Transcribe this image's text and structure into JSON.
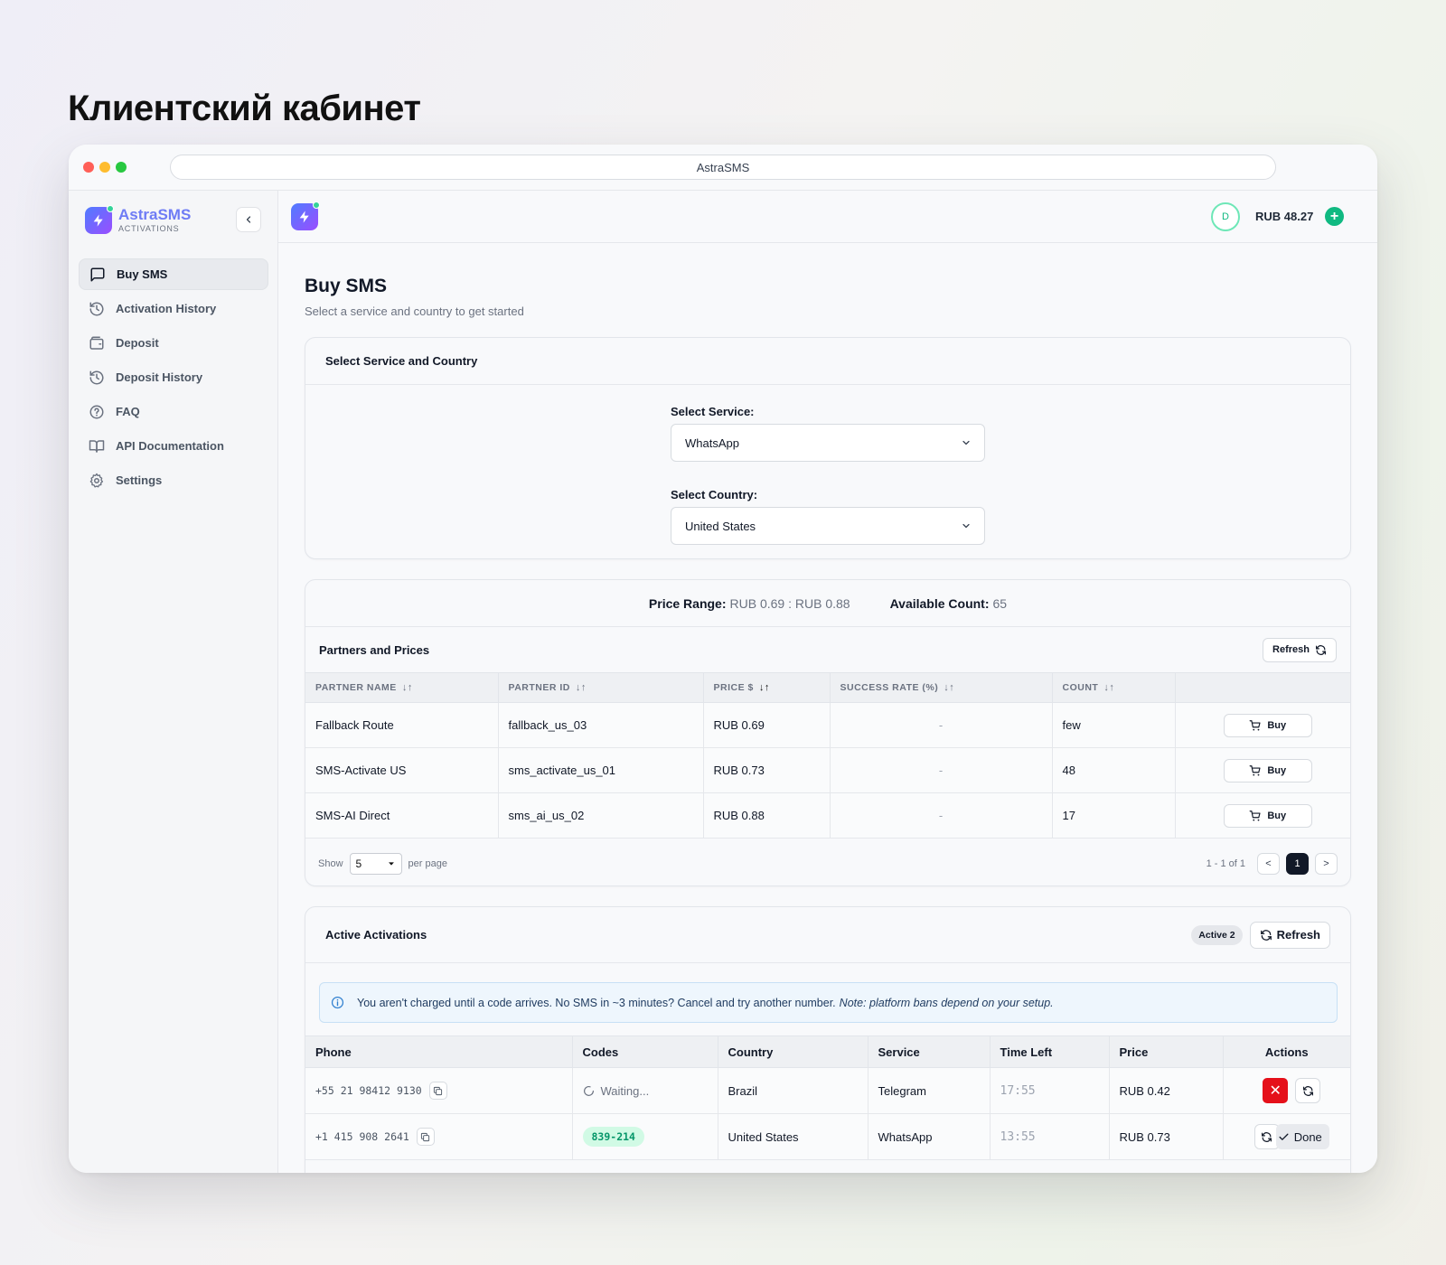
{
  "page_heading": "Клиентский кабинет",
  "browser": {
    "url_title": "AstraSMS"
  },
  "brand": {
    "name": "AstraSMS",
    "subtitle": "ACTIVATIONS"
  },
  "sidebar": {
    "items": [
      {
        "label": "Buy SMS",
        "icon": "message-square-icon",
        "active": true
      },
      {
        "label": "Activation History",
        "icon": "history-icon"
      },
      {
        "label": "Deposit",
        "icon": "wallet-icon"
      },
      {
        "label": "Deposit History",
        "icon": "history-icon"
      },
      {
        "label": "FAQ",
        "icon": "help-circle-icon"
      },
      {
        "label": "API Documentation",
        "icon": "book-open-icon"
      },
      {
        "label": "Settings",
        "icon": "gear-icon"
      }
    ]
  },
  "topbar": {
    "avatar_initial": "D",
    "balance": "RUB 48.27",
    "add_label": "+"
  },
  "main": {
    "title": "Buy SMS",
    "subtitle": "Select a service and country to get started"
  },
  "selector": {
    "header": "Select Service and Country",
    "service_label": "Select Service:",
    "service_value": "WhatsApp",
    "country_label": "Select Country:",
    "country_value": "United States"
  },
  "summary": {
    "price_range_label": "Price Range:",
    "price_range_value": "RUB 0.69 : RUB 0.88",
    "available_label": "Available Count:",
    "available_value": "65"
  },
  "partners": {
    "header": "Partners and Prices",
    "refresh_label": "Refresh",
    "columns": [
      "PARTNER NAME",
      "PARTNER ID",
      "PRICE $",
      "SUCCESS RATE (%)",
      "COUNT"
    ],
    "rows": [
      {
        "name": "Fallback Route",
        "id": "fallback_us_03",
        "price": "RUB 0.69",
        "success": "-",
        "count": "few",
        "action": "Buy"
      },
      {
        "name": "SMS-Activate US",
        "id": "sms_activate_us_01",
        "price": "RUB 0.73",
        "success": "-",
        "count": "48",
        "action": "Buy"
      },
      {
        "name": "SMS-AI Direct",
        "id": "sms_ai_us_02",
        "price": "RUB 0.88",
        "success": "-",
        "count": "17",
        "action": "Buy"
      }
    ],
    "pager": {
      "show_label": "Show",
      "per_page_value": "5",
      "per_page_label": "per page",
      "range": "1 - 1 of 1",
      "prev": "<",
      "current": "1",
      "next": ">"
    }
  },
  "activations": {
    "header": "Active Activations",
    "badge": "Active 2",
    "refresh_label": "Refresh",
    "alert_text": "You aren't charged until a code arrives. No SMS in ~3 minutes? Cancel and try another number.",
    "alert_note": "Note: platform bans depend on your setup.",
    "columns": [
      "Phone",
      "Codes",
      "Country",
      "Service",
      "Time Left",
      "Price",
      "Actions"
    ],
    "rows": [
      {
        "phone": "+55 21 98412 9130",
        "code": "Waiting...",
        "country": "Brazil",
        "service": "Telegram",
        "time_left": "17:55",
        "price": "RUB 0.42",
        "cancel": "✕"
      },
      {
        "phone": "+1 415 908 2641",
        "code": "839-214",
        "country": "United States",
        "service": "WhatsApp",
        "time_left": "13:55",
        "price": "RUB 0.73",
        "done_label": "Done"
      }
    ]
  },
  "colors": {
    "accent": "#6e7cf5",
    "success": "#10b981",
    "danger": "#e5101a",
    "dark": "#111827"
  }
}
